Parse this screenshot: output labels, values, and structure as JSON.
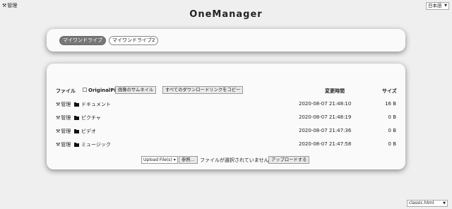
{
  "header": {
    "admin_label": "管理",
    "title": "OneManager",
    "language": "日本語"
  },
  "drives": [
    {
      "label": "マイワンドライブ",
      "active": true
    },
    {
      "label": "マイワンドライブ2",
      "active": false
    }
  ],
  "file_table": {
    "col_file": "ファイル",
    "original_pic_label": "OriginalPic",
    "original_pic_checked": false,
    "thumbnail_button": "画像のサムネイル",
    "copy_links_button": "すべてのダウンロードリンクをコピー",
    "col_modified": "変更時間",
    "col_size": "サイズ",
    "rows": [
      {
        "admin": "管理",
        "name": "ドキュメント",
        "time": "2020-08-07 21:48:10",
        "size": "16 B"
      },
      {
        "admin": "管理",
        "name": "ピクチャ",
        "time": "2020-08-07 21:48:19",
        "size": "0 B"
      },
      {
        "admin": "管理",
        "name": "ビデオ",
        "time": "2020-08-07 21:47:36",
        "size": "0 B"
      },
      {
        "admin": "管理",
        "name": "ミュージック",
        "time": "2020-08-07 21:47:58",
        "size": "0 B"
      }
    ]
  },
  "upload": {
    "mode": "Upload File(s)",
    "browse_button": "参照...",
    "no_file_text": "ファイルが選択されていません。",
    "upload_button": "アップロードする"
  },
  "footer": {
    "theme": "classic.html"
  }
}
